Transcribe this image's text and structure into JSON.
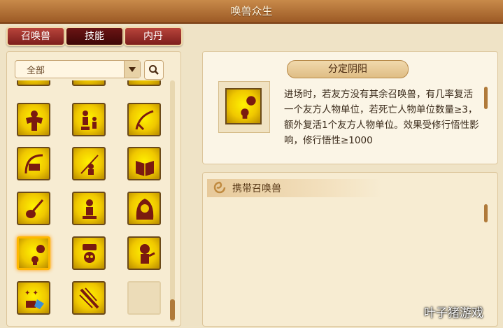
{
  "window": {
    "title": "唤兽众生"
  },
  "tabs": [
    {
      "label": "召唤兽",
      "active": false
    },
    {
      "label": "技能",
      "active": true
    },
    {
      "label": "内丹",
      "active": false
    }
  ],
  "filter": {
    "selected": "全部",
    "arrow_icon": "dropdown-arrow-icon",
    "search_icon": "search-icon"
  },
  "skill_grid": {
    "rows": [
      [
        "skill-muscle-icon",
        "skill-figures-icon",
        "skill-whip-icon"
      ],
      [
        "skill-scroll-bow-icon",
        "skill-fishing-icon",
        "skill-book-icon"
      ],
      [
        "skill-guitar-icon",
        "skill-figure-icon",
        "skill-hooded-icon"
      ],
      [
        "skill-moon-skull-icon",
        "skill-coffin-skull-icon",
        "skill-zombie-icon"
      ],
      [
        "skill-sparkle-gem-icon",
        "skill-blades-icon",
        "empty-slot"
      ]
    ],
    "selected": "skill-moon-skull-icon"
  },
  "detail": {
    "skill_name": "分定阴阳",
    "icon": "skill-moon-skull-icon",
    "description": "进场时，若友方没有其余召唤兽，有几率复活一个友方人物单位，若死亡人物单位数量≥3，额外复活1个友方人物单位。效果受修行悟性影响，修行悟性≥1000"
  },
  "carry": {
    "title": "携带召唤兽",
    "icon": "swirl-icon"
  },
  "watermark": "叶子猪游戏",
  "colors": {
    "tab_red": "#8f2a24",
    "tab_active": "#4a0b0b",
    "skill_gold": "#f0c800",
    "title_bar": "#b27038"
  }
}
